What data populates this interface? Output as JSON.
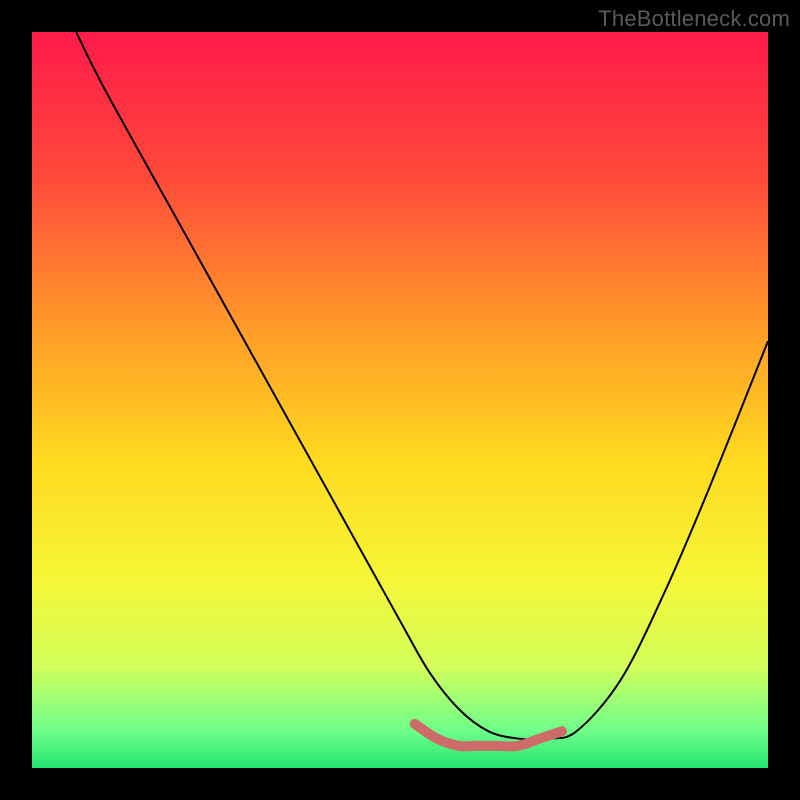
{
  "watermark": "TheBottleneck.com",
  "chart_data": {
    "type": "line",
    "title": "",
    "xlabel": "",
    "ylabel": "",
    "xlim": [
      0,
      100
    ],
    "ylim": [
      0,
      100
    ],
    "grid": false,
    "legend": false,
    "gradient_stops": [
      {
        "offset": 0.0,
        "color": "#ff1a4b"
      },
      {
        "offset": 0.2,
        "color": "#ff4a3a"
      },
      {
        "offset": 0.4,
        "color": "#ff9a28"
      },
      {
        "offset": 0.58,
        "color": "#ffd91f"
      },
      {
        "offset": 0.74,
        "color": "#f6f636"
      },
      {
        "offset": 0.86,
        "color": "#d4ff5a"
      },
      {
        "offset": 0.95,
        "color": "#6dff8a"
      },
      {
        "offset": 1.0,
        "color": "#22e56e"
      }
    ],
    "series": [
      {
        "name": "bottleneck-curve",
        "x": [
          6,
          10,
          20,
          30,
          40,
          50,
          54,
          58,
          62,
          66,
          70,
          74,
          80,
          86,
          92,
          100
        ],
        "values": [
          100,
          92,
          74,
          56,
          38,
          20,
          13,
          8,
          5,
          4,
          4,
          5,
          12,
          24,
          38,
          58
        ]
      }
    ],
    "flat_band": {
      "name": "plateau-marker",
      "color": "#cc6b68",
      "x": [
        52,
        55,
        58,
        60,
        63,
        66,
        69,
        72
      ],
      "values": [
        6,
        4,
        3,
        3,
        3,
        3,
        4,
        5
      ]
    }
  }
}
